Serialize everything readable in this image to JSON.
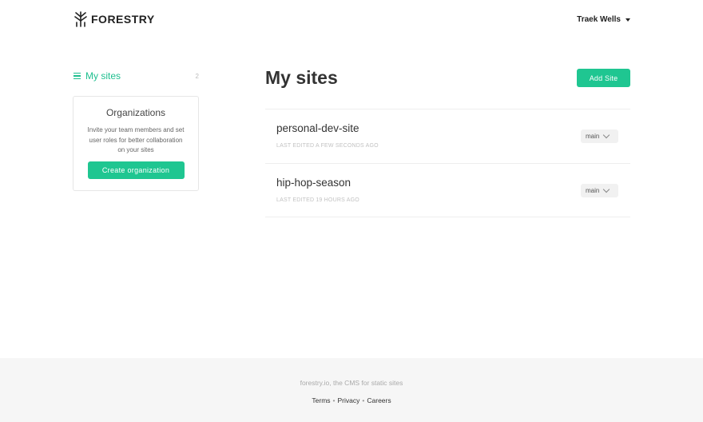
{
  "header": {
    "brand": "FORESTRY",
    "user_name": "Traek Wells"
  },
  "sidebar": {
    "nav_label": "My sites",
    "nav_count": "2",
    "org_card": {
      "title": "Organizations",
      "description": "Invite your team members and set user roles for better collaboration on your sites",
      "button_label": "Create organization"
    }
  },
  "main": {
    "title": "My sites",
    "add_button_label": "Add Site",
    "sites": [
      {
        "name": "personal-dev-site",
        "meta": "LAST EDITED A FEW SECONDS AGO",
        "branch": "main"
      },
      {
        "name": "hip-hop-season",
        "meta": "LAST EDITED 19 HOURS AGO",
        "branch": "main"
      }
    ]
  },
  "footer": {
    "tagline": "forestry.io, the CMS for static sites",
    "links": [
      "Terms",
      "Privacy",
      "Careers"
    ]
  },
  "colors": {
    "accent": "#1fc691",
    "footer_bg": "#f6f6f6"
  }
}
